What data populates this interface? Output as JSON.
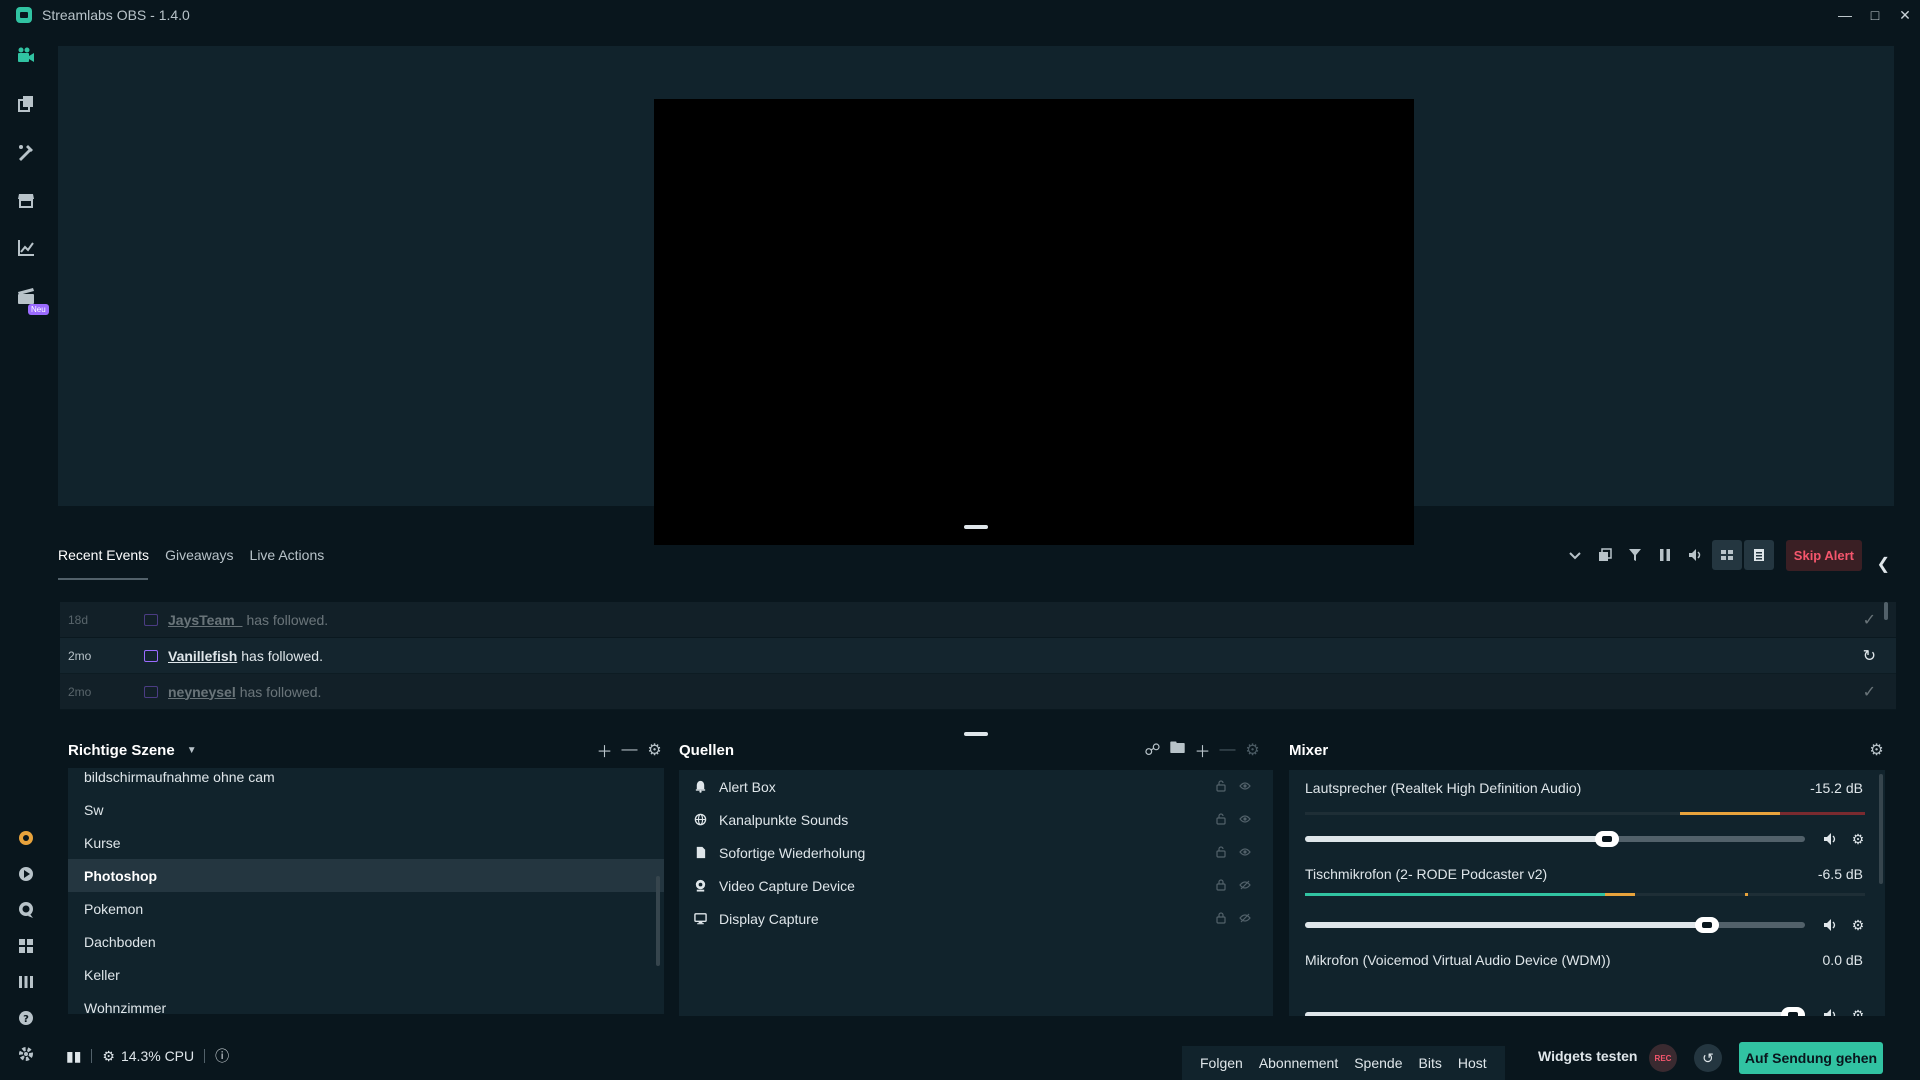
{
  "window": {
    "title": "Streamlabs OBS - 1.4.0"
  },
  "colors": {
    "accent": "#31c3a2",
    "background": "#09161d",
    "panel": "#11232c",
    "danger": "#f5566d",
    "twitch": "#9b6bff"
  },
  "nav": {
    "top_icons": [
      "studio-icon",
      "themes-icon",
      "editor-icon",
      "store-icon",
      "analytics-icon",
      "highlighter-icon"
    ],
    "new_badge": "Neu",
    "bottom_icons": [
      "prime-icon",
      "dashboard-icon",
      "chat-icon",
      "layout-icon",
      "studio-mode-icon",
      "help-icon",
      "settings-icon"
    ]
  },
  "events": {
    "tabs": [
      "Recent Events",
      "Giveaways",
      "Live Actions"
    ],
    "skip_alert": "Skip Alert",
    "rows": [
      {
        "time": "18d",
        "name": "JaysTeam_",
        "text": "has followed."
      },
      {
        "time": "2mo",
        "name": "Vanillefish",
        "text": "has followed."
      },
      {
        "time": "2mo",
        "name": "neyneysel",
        "text": "has followed."
      }
    ]
  },
  "scenes": {
    "title": "Richtige Szene",
    "items": [
      "bildschirmaufnahme ohne cam",
      "Sw",
      "Kurse",
      "Photoshop",
      "Pokemon",
      "Dachboden",
      "Keller",
      "Wohnzimmer"
    ],
    "selected": "Photoshop"
  },
  "sources": {
    "title": "Quellen",
    "items": [
      {
        "name": "Alert Box",
        "icon": "bell-icon"
      },
      {
        "name": "Kanalpunkte Sounds",
        "icon": "globe-icon"
      },
      {
        "name": "Sofortige Wiederholung",
        "icon": "file-icon"
      },
      {
        "name": "Video Capture Device",
        "icon": "webcam-icon"
      },
      {
        "name": "Display Capture",
        "icon": "monitor-icon"
      }
    ]
  },
  "mixer": {
    "title": "Mixer",
    "channels": [
      {
        "name": "Lautsprecher (Realtek High Definition Audio)",
        "db": "-15.2 dB",
        "volume": 0.61
      },
      {
        "name": "Tischmikrofon (2- RODE Podcaster v2)",
        "db": "-6.5 dB",
        "volume": 0.82
      },
      {
        "name": "Mikrofon (Voicemod Virtual Audio Device (WDM))",
        "db": "0.0 dB",
        "volume": 1.0
      }
    ]
  },
  "footer": {
    "cpu": "14.3% CPU",
    "test_buttons": [
      "Folgen",
      "Abonnement",
      "Spende",
      "Bits",
      "Host"
    ],
    "widgets_label": "Widgets testen",
    "rec_label": "REC",
    "go_live": "Auf Sendung gehen"
  }
}
